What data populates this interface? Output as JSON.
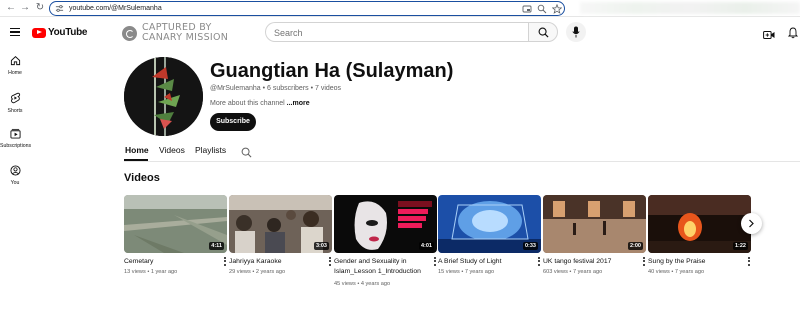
{
  "browser": {
    "url": "youtube.com/@MrSulemanha"
  },
  "masthead": {
    "logo_text": "YouTube",
    "watermark_line1": "CAPTURED BY",
    "watermark_line2": "CANARY MISSION",
    "search_placeholder": "Search"
  },
  "leftnav": {
    "items": [
      {
        "label": "Home",
        "icon": "home-icon"
      },
      {
        "label": "Shorts",
        "icon": "shorts-icon"
      },
      {
        "label": "Subscriptions",
        "icon": "subscriptions-icon"
      },
      {
        "label": "You",
        "icon": "you-icon"
      }
    ]
  },
  "channel": {
    "name": "Guangtian Ha (Sulayman)",
    "meta": "@MrSulemanha • 6 subscribers • 7 videos",
    "description": "More about this channel",
    "more_label": "...more",
    "subscribe_label": "Subscribe"
  },
  "tabs": [
    {
      "label": "Home",
      "active": true
    },
    {
      "label": "Videos",
      "active": false
    },
    {
      "label": "Playlists",
      "active": false
    }
  ],
  "section": {
    "title": "Videos"
  },
  "videos": [
    {
      "title": "Cemetary",
      "duration": "4:11",
      "views": "13 views",
      "age": "1 year ago"
    },
    {
      "title": "Jahriyya Karaoke",
      "duration": "3:03",
      "views": "29 views",
      "age": "2 years ago"
    },
    {
      "title": "Gender and Sexuality in Islam_Lesson 1_Introduction",
      "duration": "4:01",
      "views": "45 views",
      "age": "4 years ago"
    },
    {
      "title": "A Brief Study of Light",
      "duration": "0:33",
      "views": "15 views",
      "age": "7 years ago"
    },
    {
      "title": "UK tango festival 2017",
      "duration": "2:00",
      "views": "603 views",
      "age": "7 years ago"
    },
    {
      "title": "Sung by the Praise",
      "duration": "1:22",
      "views": "40 views",
      "age": "7 years ago"
    }
  ],
  "colors": {
    "brand_red": "#ff0000",
    "text_primary": "#0f0f0f",
    "text_secondary": "#606060",
    "address_border": "#1a4fa0"
  }
}
